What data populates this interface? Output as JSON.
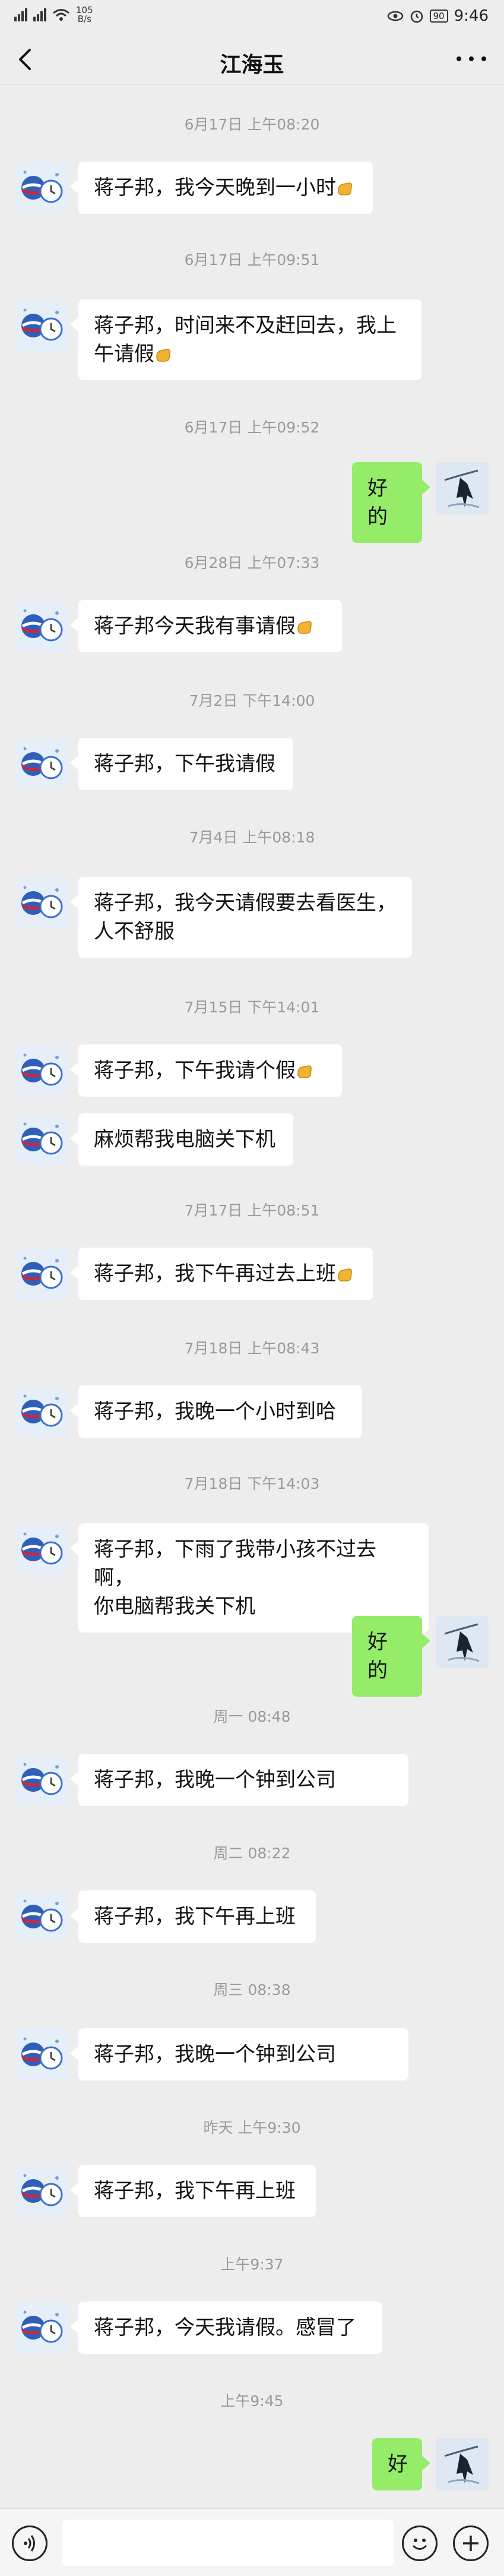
{
  "status_bar": {
    "net_speed_value": "105",
    "net_speed_unit": "B/s",
    "battery": "90",
    "time": "9:46"
  },
  "header": {
    "title": "江海玉",
    "icons": [
      "back-arrow-icon",
      "more-dots-icon"
    ]
  },
  "chat": {
    "contact_avatar": "pepsi-clock-avatar",
    "self_avatar": "ink-figure-avatar",
    "items": [
      {
        "type": "time",
        "text": "6月17日 上午08:20"
      },
      {
        "type": "in",
        "text": "蒋子邦，我今天晚到一小时",
        "emoji": "fist-emoji"
      },
      {
        "type": "time",
        "text": "6月17日 上午09:51"
      },
      {
        "type": "in",
        "text": "蒋子邦，时间来不及赶回去，我上\n午请假",
        "emoji": "fist-emoji"
      },
      {
        "type": "time",
        "text": "6月17日 上午09:52"
      },
      {
        "type": "out",
        "text": "好的"
      },
      {
        "type": "time",
        "text": "6月28日 上午07:33"
      },
      {
        "type": "in",
        "text": "蒋子邦今天我有事请假",
        "emoji": "fist-emoji"
      },
      {
        "type": "time",
        "text": "7月2日 下午14:00"
      },
      {
        "type": "in",
        "text": "蒋子邦，下午我请假"
      },
      {
        "type": "time",
        "text": "7月4日 上午08:18"
      },
      {
        "type": "in",
        "text": "蒋子邦，我今天请假要去看医生，\n人不舒服"
      },
      {
        "type": "time",
        "text": "7月15日 下午14:01"
      },
      {
        "type": "in",
        "text": "蒋子邦，下午我请个假",
        "emoji": "fist-emoji"
      },
      {
        "type": "in",
        "text": "麻烦帮我电脑关下机"
      },
      {
        "type": "time",
        "text": "7月17日 上午08:51"
      },
      {
        "type": "in",
        "text": "蒋子邦，我下午再过去上班",
        "emoji": "fist-emoji"
      },
      {
        "type": "time",
        "text": "7月18日 上午08:43"
      },
      {
        "type": "in",
        "text": "蒋子邦，我晚一个小时到哈"
      },
      {
        "type": "time",
        "text": "7月18日 下午14:03"
      },
      {
        "type": "in",
        "text": "蒋子邦，下雨了我带小孩不过去啊，\n你电脑帮我关下机"
      },
      {
        "type": "out",
        "text": "好的"
      },
      {
        "type": "time",
        "text": "周一 08:48"
      },
      {
        "type": "in",
        "text": "蒋子邦，我晚一个钟到公司"
      },
      {
        "type": "time",
        "text": "周二 08:22"
      },
      {
        "type": "in",
        "text": "蒋子邦，我下午再上班"
      },
      {
        "type": "time",
        "text": "周三 08:38"
      },
      {
        "type": "in",
        "text": "蒋子邦，我晚一个钟到公司"
      },
      {
        "type": "time",
        "text": "昨天 上午9:30"
      },
      {
        "type": "in",
        "text": "蒋子邦，我下午再上班"
      },
      {
        "type": "time",
        "text": "上午9:37"
      },
      {
        "type": "in",
        "text": "蒋子邦，今天我请假。感冒了"
      },
      {
        "type": "time",
        "text": "上午9:45"
      },
      {
        "type": "out",
        "text": "好"
      }
    ]
  },
  "input_bar": {
    "icons": [
      "voice-icon",
      "emoji-icon",
      "plus-icon"
    ],
    "placeholder": ""
  },
  "colors": {
    "background": "#ededed",
    "incoming_bubble": "#ffffff",
    "outgoing_bubble": "#95ec69",
    "timestamp_text": "#9a9a9a"
  }
}
